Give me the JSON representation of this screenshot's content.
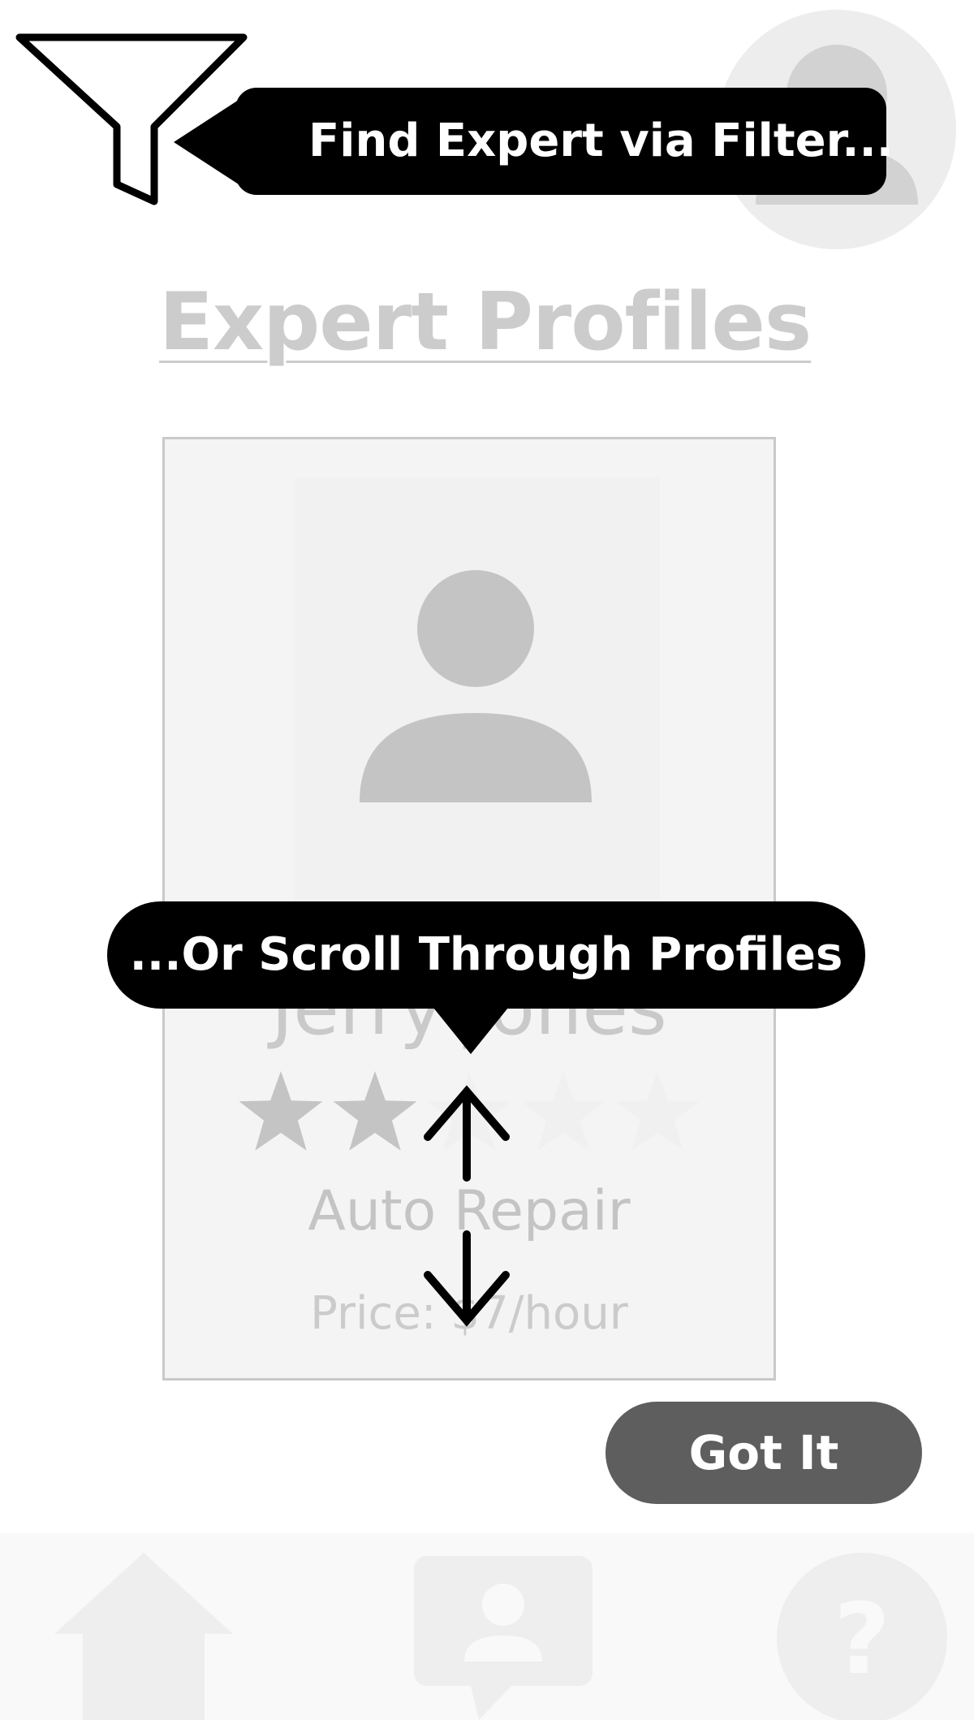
{
  "header": {
    "filter_tooltip": "Find Expert via Filter..."
  },
  "main": {
    "title": "Expert Profiles",
    "expert_card": {
      "name": "Jerry Jones",
      "rating": 2,
      "rating_max": 5,
      "specialty": "Auto Repair",
      "price": "Price: $7/hour"
    },
    "scroll_tooltip": "...Or Scroll Through Profiles"
  },
  "actions": {
    "got_it_label": "Got It"
  },
  "bottom_nav": {
    "items": [
      "home-icon",
      "expert-chat-icon",
      "help-icon"
    ]
  },
  "colors": {
    "overlay_black": "#000000",
    "button_gray": "#5e5e5e",
    "muted_gray": "#cccccc"
  }
}
